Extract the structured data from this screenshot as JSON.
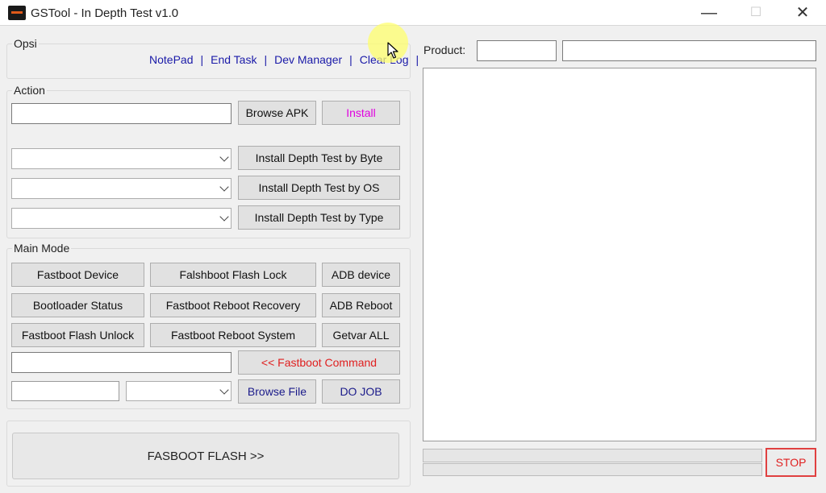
{
  "window": {
    "title": "GSTool - In Depth Test v1.0",
    "minimize_glyph": "—",
    "maximize_glyph": "☐",
    "close_glyph": "✕"
  },
  "opsi": {
    "label": "Opsi",
    "links": [
      "NotePad",
      "End Task",
      "Dev Manager",
      "Clear Log"
    ],
    "separator": "|"
  },
  "action": {
    "label": "Action",
    "apk_path": "",
    "browse_apk": "Browse APK",
    "install": "Install",
    "byte_select": "",
    "os_select": "",
    "type_select": "",
    "by_byte": "Install Depth Test by Byte",
    "by_os": "Install Depth Test by OS",
    "by_type": "Install Depth Test by Type"
  },
  "main_mode": {
    "label": "Main Mode",
    "fastboot_device": "Fastboot Device",
    "flash_lock": "Falshboot Flash Lock",
    "adb_device": "ADB device",
    "bootloader_status": "Bootloader Status",
    "reboot_recovery": "Fastboot Reboot Recovery",
    "adb_reboot": "ADB Reboot",
    "flash_unlock": "Fastboot Flash Unlock",
    "reboot_system": "Fastboot Reboot System",
    "getvar_all": "Getvar ALL",
    "command_input": "",
    "fastboot_command": "<< Fastboot Command",
    "file_field": "",
    "file_select": "",
    "browse_file": "Browse File",
    "do_job": "DO JOB"
  },
  "fasboot_flash": "FASBOOT FLASH  >>",
  "product": {
    "label": "Product:",
    "field1": "",
    "field2": ""
  },
  "log": "",
  "progress": {
    "bar1": 0,
    "bar2": 0
  },
  "stop": "STOP",
  "colors": {
    "link": "#1a1aa8",
    "install_text": "#e000e0",
    "command_text": "#e02020",
    "stop_border": "#e04040"
  },
  "icons": [
    "app-icon",
    "chevron-down-icon",
    "mouse-pointer-icon"
  ]
}
